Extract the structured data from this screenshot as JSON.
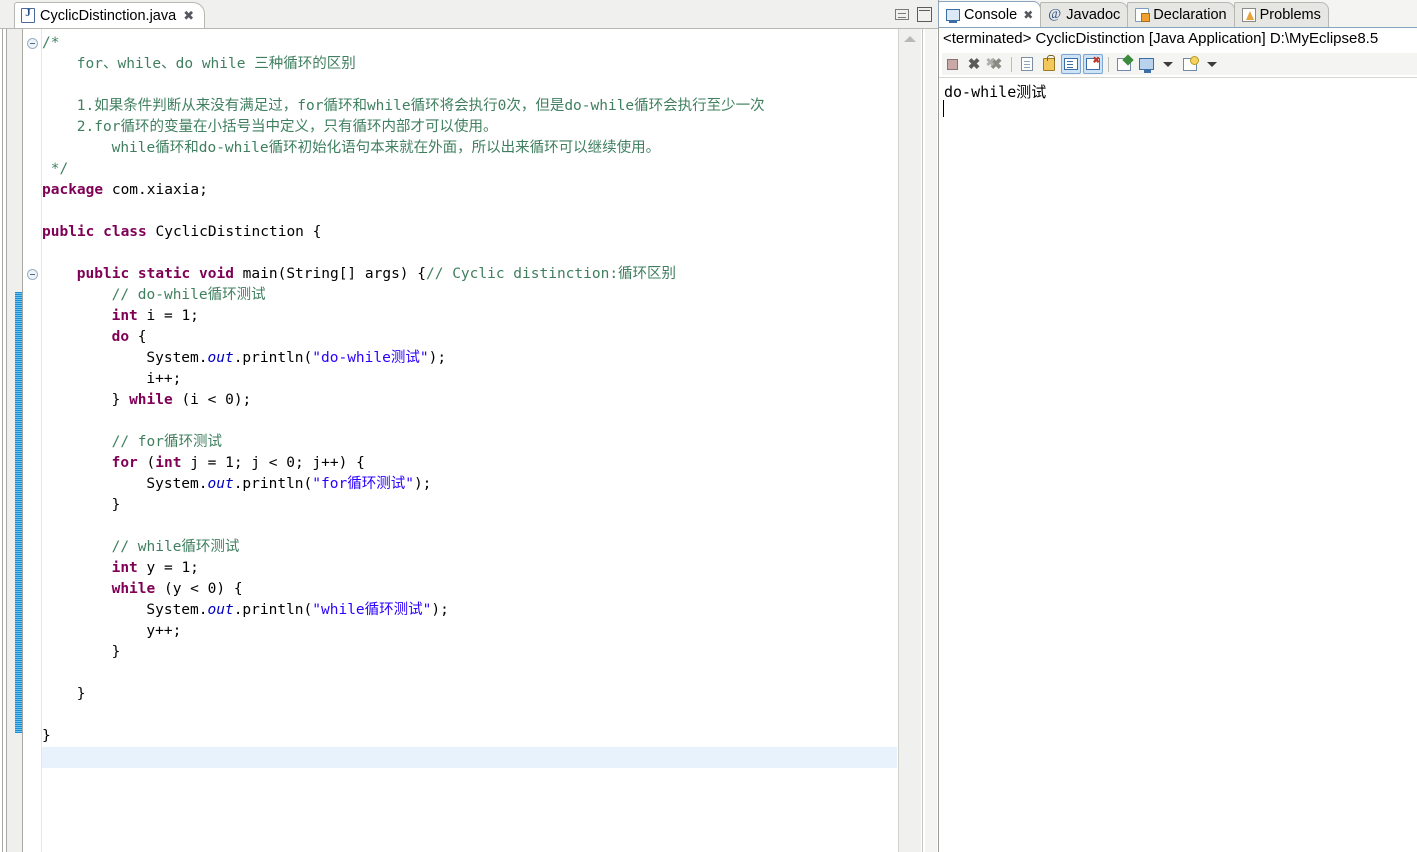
{
  "editor": {
    "tab": {
      "title": "CyclicDistinction.java",
      "file_icon": "java-file-icon",
      "close_glyph": "✖"
    },
    "window_buttons": {
      "minimize_label": "Minimize",
      "maximize_label": "Maximize"
    },
    "colors": {
      "keyword": "#7f0055",
      "string": "#2a00ff",
      "comment": "#3f7f5f",
      "field": "#0000c0",
      "current_line": "#e8f2fd",
      "change_bar": "#1b8fd4"
    },
    "code_lines": [
      {
        "indent": 0,
        "tokens": [
          {
            "t": "/*",
            "c": "cmt"
          }
        ]
      },
      {
        "indent": 1,
        "tokens": [
          {
            "t": "for、while、do while 三种循环的区别",
            "c": "cmt"
          }
        ]
      },
      {
        "indent": 0,
        "tokens": [
          {
            "t": "",
            "c": "cmt"
          }
        ]
      },
      {
        "indent": 1,
        "tokens": [
          {
            "t": "1.如果条件判断从来没有满足过，for循环和while循环将会执行0次，但是do-while循环会执行至少一次",
            "c": "cmt"
          }
        ]
      },
      {
        "indent": 1,
        "tokens": [
          {
            "t": "2.for循环的变量在小括号当中定义，只有循环内部才可以使用。",
            "c": "cmt"
          }
        ]
      },
      {
        "indent": 2,
        "tokens": [
          {
            "t": "while循环和do-while循环初始化语句本来就在外面，所以出来循环可以继续使用。",
            "c": "cmt"
          }
        ]
      },
      {
        "indent": 0,
        "tokens": [
          {
            "t": " */",
            "c": "cmt"
          }
        ]
      },
      {
        "indent": 0,
        "tokens": [
          {
            "t": "package",
            "c": "kw"
          },
          {
            "t": " com.xiaxia;",
            "c": ""
          }
        ]
      },
      {
        "indent": 0,
        "tokens": [
          {
            "t": "",
            "c": ""
          }
        ]
      },
      {
        "indent": 0,
        "tokens": [
          {
            "t": "public class",
            "c": "kw"
          },
          {
            "t": " CyclicDistinction {",
            "c": ""
          }
        ]
      },
      {
        "indent": 0,
        "tokens": [
          {
            "t": "",
            "c": ""
          }
        ]
      },
      {
        "indent": 1,
        "tokens": [
          {
            "t": "public static void",
            "c": "kw"
          },
          {
            "t": " main(String[] args) {",
            "c": ""
          },
          {
            "t": "// Cyclic distinction:循环区别",
            "c": "cmt"
          }
        ]
      },
      {
        "indent": 2,
        "tokens": [
          {
            "t": "// do-while循环测试",
            "c": "cmt"
          }
        ]
      },
      {
        "indent": 2,
        "tokens": [
          {
            "t": "int",
            "c": "kw"
          },
          {
            "t": " i = 1;",
            "c": ""
          }
        ]
      },
      {
        "indent": 2,
        "tokens": [
          {
            "t": "do",
            "c": "kw"
          },
          {
            "t": " {",
            "c": ""
          }
        ]
      },
      {
        "indent": 3,
        "tokens": [
          {
            "t": "System.",
            "c": ""
          },
          {
            "t": "out",
            "c": "fld"
          },
          {
            "t": ".println(",
            "c": ""
          },
          {
            "t": "\"do-while测试\"",
            "c": "str"
          },
          {
            "t": ");",
            "c": ""
          }
        ]
      },
      {
        "indent": 3,
        "tokens": [
          {
            "t": "i++;",
            "c": ""
          }
        ]
      },
      {
        "indent": 2,
        "tokens": [
          {
            "t": "} ",
            "c": ""
          },
          {
            "t": "while",
            "c": "kw"
          },
          {
            "t": " (i < 0);",
            "c": ""
          }
        ]
      },
      {
        "indent": 0,
        "tokens": [
          {
            "t": "",
            "c": ""
          }
        ]
      },
      {
        "indent": 2,
        "tokens": [
          {
            "t": "// for循环测试",
            "c": "cmt"
          }
        ]
      },
      {
        "indent": 2,
        "tokens": [
          {
            "t": "for",
            "c": "kw"
          },
          {
            "t": " (",
            "c": ""
          },
          {
            "t": "int",
            "c": "kw"
          },
          {
            "t": " j = 1; j < 0; j++) {",
            "c": ""
          }
        ]
      },
      {
        "indent": 3,
        "tokens": [
          {
            "t": "System.",
            "c": ""
          },
          {
            "t": "out",
            "c": "fld"
          },
          {
            "t": ".println(",
            "c": ""
          },
          {
            "t": "\"for循环测试\"",
            "c": "str"
          },
          {
            "t": ");",
            "c": ""
          }
        ]
      },
      {
        "indent": 2,
        "tokens": [
          {
            "t": "}",
            "c": ""
          }
        ]
      },
      {
        "indent": 0,
        "tokens": [
          {
            "t": "",
            "c": ""
          }
        ]
      },
      {
        "indent": 2,
        "tokens": [
          {
            "t": "// while循环测试",
            "c": "cmt"
          }
        ]
      },
      {
        "indent": 2,
        "tokens": [
          {
            "t": "int",
            "c": "kw"
          },
          {
            "t": " y = 1;",
            "c": ""
          }
        ]
      },
      {
        "indent": 2,
        "tokens": [
          {
            "t": "while",
            "c": "kw"
          },
          {
            "t": " (y < 0) {",
            "c": ""
          }
        ]
      },
      {
        "indent": 3,
        "tokens": [
          {
            "t": "System.",
            "c": ""
          },
          {
            "t": "out",
            "c": "fld"
          },
          {
            "t": ".println(",
            "c": ""
          },
          {
            "t": "\"while循环测试\"",
            "c": "str"
          },
          {
            "t": ");",
            "c": ""
          }
        ]
      },
      {
        "indent": 3,
        "tokens": [
          {
            "t": "y++;",
            "c": ""
          }
        ]
      },
      {
        "indent": 2,
        "tokens": [
          {
            "t": "}",
            "c": ""
          }
        ]
      },
      {
        "indent": 0,
        "tokens": [
          {
            "t": "",
            "c": ""
          }
        ]
      },
      {
        "indent": 1,
        "tokens": [
          {
            "t": "}",
            "c": ""
          }
        ]
      },
      {
        "indent": 0,
        "tokens": [
          {
            "t": "",
            "c": ""
          }
        ]
      },
      {
        "indent": 0,
        "tokens": [
          {
            "t": "}",
            "c": ""
          }
        ]
      }
    ]
  },
  "console": {
    "tabs": [
      {
        "label": "Console",
        "icon": "console-icon",
        "active": true,
        "closable": true
      },
      {
        "label": "Javadoc",
        "icon": "javadoc-icon",
        "active": false,
        "closable": false
      },
      {
        "label": "Declaration",
        "icon": "declaration-icon",
        "active": false,
        "closable": false
      },
      {
        "label": "Problems",
        "icon": "problems-icon",
        "active": false,
        "closable": false
      }
    ],
    "close_glyph": "✖",
    "javadoc_glyph": "@",
    "launch_line": "<terminated> CyclicDistinction [Java Application] D:\\MyEclipse8.5",
    "toolbar": [
      {
        "name": "terminate-button",
        "icon": "terminate-icon",
        "toggled": false
      },
      {
        "name": "remove-launch-button",
        "icon": "remove-icon",
        "toggled": false
      },
      {
        "name": "remove-all-terminated-button",
        "icon": "remove-all-icon",
        "toggled": false
      },
      {
        "name": "clear-console-button",
        "icon": "clear-console-icon",
        "toggled": false
      },
      {
        "name": "scroll-lock-button",
        "icon": "scroll-lock-icon",
        "toggled": false
      },
      {
        "name": "show-console-on-output-button",
        "icon": "show-console-icon",
        "toggled": true
      },
      {
        "name": "show-console-on-error-button",
        "icon": "show-console-error-icon",
        "toggled": true
      },
      {
        "name": "pin-console-button",
        "icon": "pin-icon",
        "toggled": false
      },
      {
        "name": "display-selected-console-button",
        "icon": "display-console-icon",
        "toggled": false
      },
      {
        "name": "open-console-button",
        "icon": "new-console-icon",
        "toggled": false
      }
    ],
    "output": "do-while测试"
  }
}
